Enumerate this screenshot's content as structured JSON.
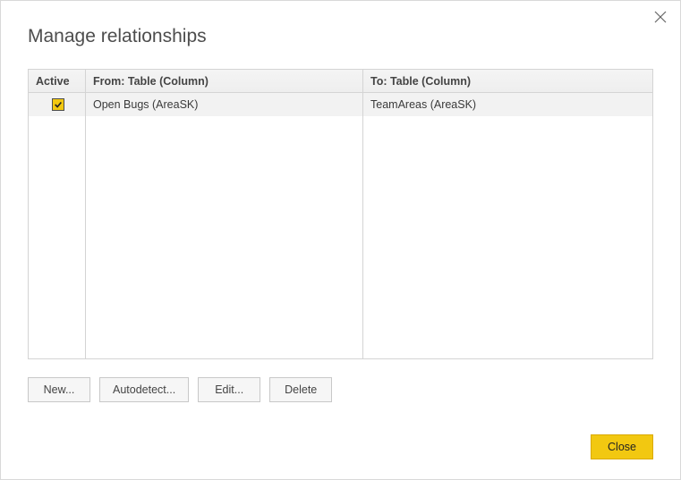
{
  "title": "Manage relationships",
  "columns": {
    "active": "Active",
    "from": "From: Table (Column)",
    "to": "To: Table (Column)"
  },
  "rows": [
    {
      "active": true,
      "from": "Open Bugs (AreaSK)",
      "to": "TeamAreas (AreaSK)"
    }
  ],
  "buttons": {
    "new": "New...",
    "autodetect": "Autodetect...",
    "edit": "Edit...",
    "delete": "Delete",
    "close": "Close"
  }
}
